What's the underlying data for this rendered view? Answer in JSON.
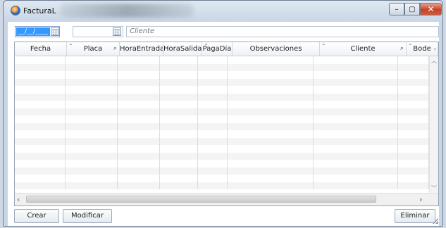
{
  "window": {
    "title": "FacturaL",
    "controls": {
      "minimize": "–",
      "maximize": "▢",
      "close": "✕"
    }
  },
  "filters": {
    "date_from": "__/__/____",
    "client_placeholder": "Cliente"
  },
  "grid": {
    "columns": [
      {
        "label": "Fecha",
        "sortable": false,
        "searchable": false
      },
      {
        "label": "Placa",
        "sortable": true,
        "searchable": true
      },
      {
        "label": "HoraEntrada",
        "sortable": false,
        "searchable": false
      },
      {
        "label": "HoraSalida",
        "sortable": false,
        "searchable": false
      },
      {
        "label": "PagaDia",
        "sortable": true,
        "searchable": false
      },
      {
        "label": "Observaciones",
        "sortable": false,
        "searchable": false
      },
      {
        "label": "Cliente",
        "sortable": true,
        "searchable": true
      },
      {
        "label": "Bode",
        "sortable": true,
        "searchable": false
      }
    ],
    "row_count": 18
  },
  "actions": {
    "create_label": "Crear",
    "modify_label": "Modificar",
    "delete_label": "Eliminar"
  },
  "colors": {
    "selection": "#3399ff",
    "title_gradient_top": "#dfe8f2",
    "close_button": "#c7422a"
  }
}
